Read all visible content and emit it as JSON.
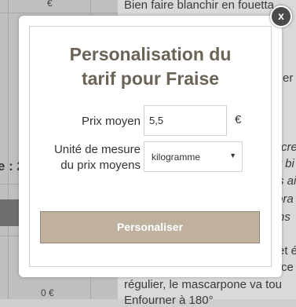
{
  "background": {
    "right_lines": [
      {
        "text": "Bien faire blanchir en fouetta",
        "italic": false
      },
      {
        "text": "er",
        "italic": false
      },
      {
        "text": "cre",
        "italic": true
      },
      {
        "text": "r bi",
        "italic": true
      },
      {
        "text": "s ai",
        "italic": true
      },
      {
        "text": "ora",
        "italic": true
      },
      {
        "text": "ns",
        "italic": true
      },
      {
        "text": "et é",
        "italic": false
      },
      {
        "text": "ce",
        "italic": false
      },
      {
        "text": "régulier, le mascarpone va tou",
        "italic": false
      },
      {
        "text": "Enfourner à 180°",
        "italic": false
      }
    ],
    "left_label": "e : 2",
    "left_price": "0 €",
    "left_top_symbol": "€"
  },
  "modal": {
    "title_line1": "Personalisation du",
    "title_line2": "tarif pour Fraise",
    "price_label": "Prix moyen",
    "price_value": "5,5",
    "currency": "€",
    "unit_label_line1": "Unité de mesure",
    "unit_label_line2": "du prix moyens",
    "unit_selected": "kilogramme",
    "submit_label": "Personaliser",
    "close_label": "x"
  }
}
